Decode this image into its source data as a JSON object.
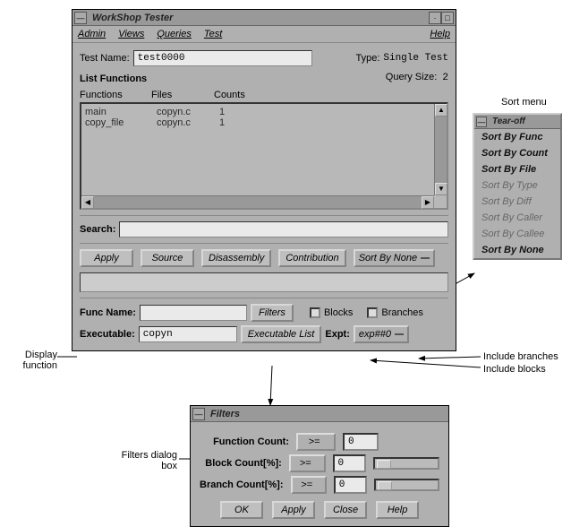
{
  "annotations": {
    "display_function": "Display\nfunction",
    "sort_menu": "Sort menu",
    "include_branches": "Include branches",
    "include_blocks": "Include blocks",
    "filters_dialog": "Filters dialog\nbox"
  },
  "main": {
    "title": "WorkShop Tester",
    "menubar": {
      "admin": "Admin",
      "views": "Views",
      "queries": "Queries",
      "test": "Test",
      "help": "Help"
    },
    "test_name_label": "Test Name:",
    "test_name_value": "test0000",
    "type_label": "Type:",
    "type_value": "Single Test",
    "list_title": "List Functions",
    "query_size_label": "Query Size:",
    "query_size_value": "2",
    "headers": {
      "functions": "Functions",
      "files": "Files",
      "counts": "Counts"
    },
    "rows": [
      {
        "fn": "main",
        "file": "copyn.c",
        "count": "1"
      },
      {
        "fn": "copy_file",
        "file": "copyn.c",
        "count": "1"
      }
    ],
    "search_label": "Search:",
    "buttons": {
      "apply": "Apply",
      "source": "Source",
      "disassembly": "Disassembly",
      "contribution": "Contribution",
      "sort": "Sort By None"
    },
    "func_name_label": "Func Name:",
    "filters_btn": "Filters",
    "blocks_label": "Blocks",
    "branches_label": "Branches",
    "executable_label": "Executable:",
    "executable_value": "copyn",
    "executable_list_btn": "Executable List",
    "expt_label": "Expt:",
    "expt_value": "exp##0"
  },
  "sortmenu": {
    "title": "Tear-off",
    "items": [
      {
        "label": "Sort By Func",
        "enabled": true
      },
      {
        "label": "Sort By Count",
        "enabled": true
      },
      {
        "label": "Sort By File",
        "enabled": true
      },
      {
        "label": "Sort By Type",
        "enabled": false
      },
      {
        "label": "Sort By Diff",
        "enabled": false
      },
      {
        "label": "Sort By Caller",
        "enabled": false
      },
      {
        "label": "Sort By Callee",
        "enabled": false
      },
      {
        "label": "Sort By None",
        "enabled": true
      }
    ]
  },
  "filters": {
    "title": "Filters",
    "func_count_label": "Function Count:",
    "block_count_label": "Block Count[%]:",
    "branch_count_label": "Branch Count[%]:",
    "op": ">=",
    "v1": "0",
    "v2": "0",
    "v3": "0",
    "buttons": {
      "ok": "OK",
      "apply": "Apply",
      "close": "Close",
      "help": "Help"
    }
  }
}
